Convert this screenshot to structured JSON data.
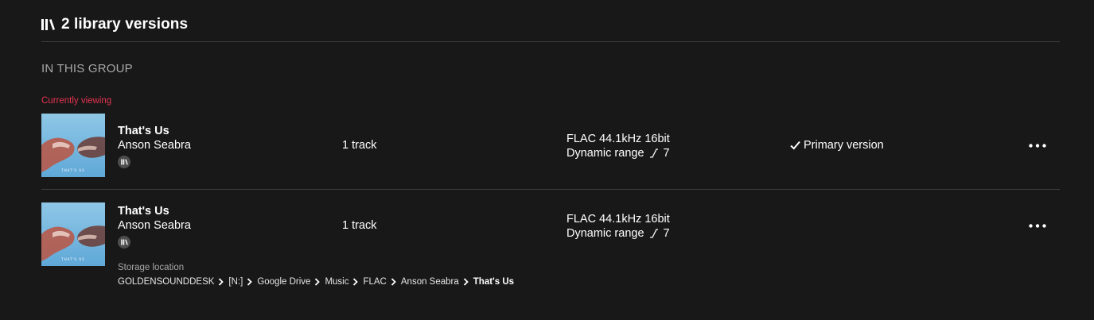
{
  "header": {
    "icon": "library-icon",
    "title": "2 library versions"
  },
  "group": {
    "label": "IN THIS GROUP",
    "current_label": "Currently viewing"
  },
  "versions": [
    {
      "album_title": "That's Us",
      "artist": "Anson Seabra",
      "badge_icon": "library-icon",
      "tracks": "1 track",
      "format": "FLAC 44.1kHz 16bit",
      "dynamic_range_label": "Dynamic range",
      "dynamic_range_value": "7",
      "primary_label": "Primary version",
      "more_icon": "more-options-icon"
    },
    {
      "album_title": "That's Us",
      "artist": "Anson Seabra",
      "badge_icon": "library-icon",
      "tracks": "1 track",
      "format": "FLAC 44.1kHz 16bit",
      "dynamic_range_label": "Dynamic range",
      "dynamic_range_value": "7",
      "more_icon": "more-options-icon",
      "storage_label": "Storage location",
      "storage_path": [
        "GOLDENSOUNDDESK",
        "[N:]",
        "Google Drive",
        "Music",
        "FLAC",
        "Anson Seabra",
        "That's Us"
      ]
    }
  ],
  "colors": {
    "background": "#181818",
    "accent": "#e5334f",
    "muted": "#a8a8a8",
    "divider": "#3c3c3c"
  }
}
